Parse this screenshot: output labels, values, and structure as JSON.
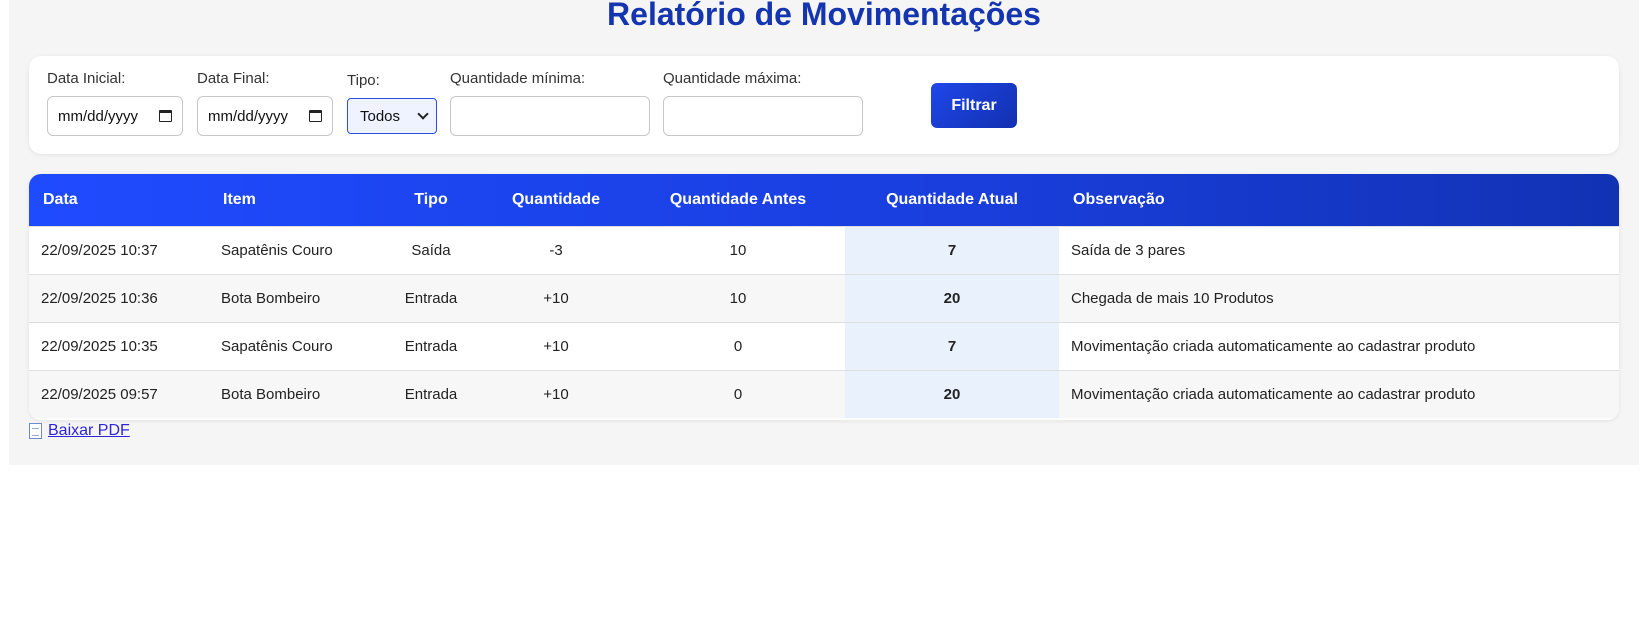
{
  "page": {
    "title": "Relatório de Movimentações"
  },
  "filters": {
    "data_inicial": {
      "label": "Data Inicial:",
      "placeholder": "mm/dd/yyyy"
    },
    "data_final": {
      "label": "Data Final:",
      "placeholder": "mm/dd/yyyy"
    },
    "tipo": {
      "label": "Tipo:",
      "selected": "Todos"
    },
    "qtd_min": {
      "label": "Quantidade mínima:",
      "value": ""
    },
    "qtd_max": {
      "label": "Quantidade máxima:",
      "value": ""
    },
    "submit_label": "Filtrar"
  },
  "table": {
    "headers": [
      "Data",
      "Item",
      "Tipo",
      "Quantidade",
      "Quantidade Antes",
      "Quantidade Atual",
      "Observação"
    ],
    "rows": [
      {
        "data": "22/09/2025 10:37",
        "item": "Sapatênis Couro",
        "tipo": "Saída",
        "quantidade": "-3",
        "antes": "10",
        "atual": "7",
        "obs": "Saída de 3 pares"
      },
      {
        "data": "22/09/2025 10:36",
        "item": "Bota Bombeiro",
        "tipo": "Entrada",
        "quantidade": "+10",
        "antes": "10",
        "atual": "20",
        "obs": "Chegada de mais 10 Produtos"
      },
      {
        "data": "22/09/2025 10:35",
        "item": "Sapatênis Couro",
        "tipo": "Entrada",
        "quantidade": "+10",
        "antes": "0",
        "atual": "7",
        "obs": "Movimentação criada automaticamente ao cadastrar produto"
      },
      {
        "data": "22/09/2025 09:57",
        "item": "Bota Bombeiro",
        "tipo": "Entrada",
        "quantidade": "+10",
        "antes": "0",
        "atual": "20",
        "obs": "Movimentação criada automaticamente ao cadastrar produto"
      }
    ]
  },
  "download": {
    "icon": "document-icon",
    "label": "Baixar PDF"
  },
  "colors": {
    "title": "#1535b0",
    "accent": "#1f47e8",
    "header_gradient_start": "#1f4bff",
    "header_gradient_end": "#1232b4",
    "highlight_cell": "#e8f1fc",
    "link": "#2f25d6"
  }
}
